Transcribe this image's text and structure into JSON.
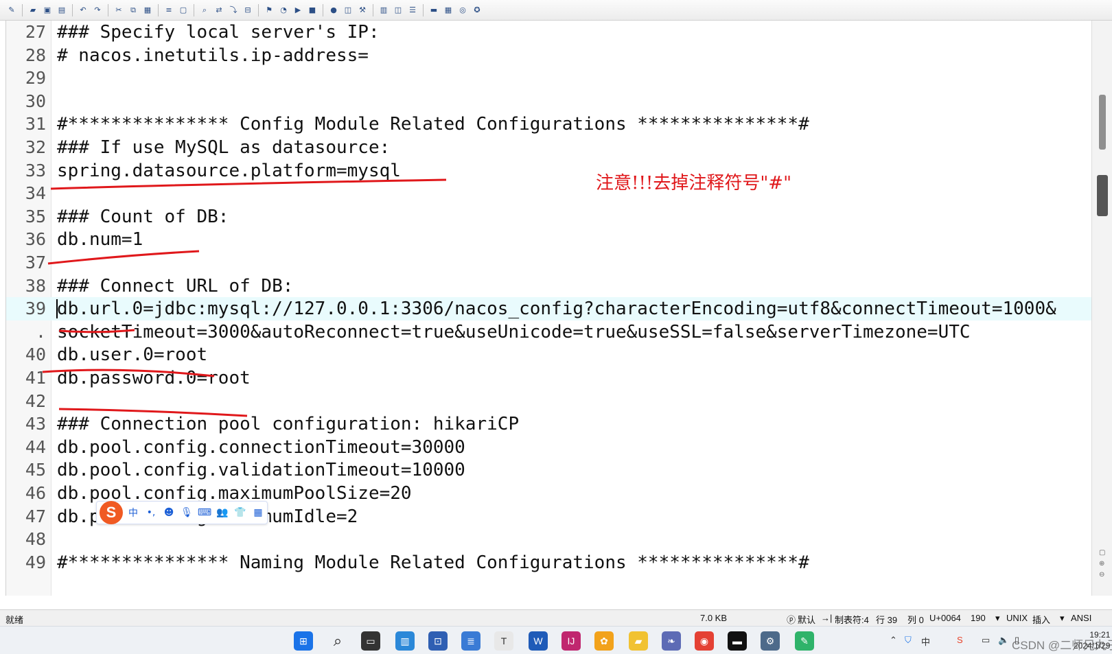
{
  "toolbar": {
    "buttons": [
      "new-icon",
      "open-icon",
      "save-icon",
      "save-all-icon",
      "undo-icon",
      "redo-icon",
      "cut-icon",
      "copy-icon",
      "paste-icon",
      "format-icon",
      "select-icon",
      "find-icon",
      "replace-icon",
      "goto-icon",
      "compare-icon",
      "bookmark-icon",
      "macro-icon",
      "macro-play-icon",
      "macro-stop-icon",
      "run-icon",
      "window-icon",
      "tools-icon",
      "view-icon",
      "split-icon",
      "list-icon",
      "console-icon",
      "column-icon",
      "browser-icon",
      "help-icon"
    ]
  },
  "editor": {
    "lines": [
      {
        "num": "27",
        "text": "### Specify local server's IP:"
      },
      {
        "num": "28",
        "text": "# nacos.inetutils.ip-address="
      },
      {
        "num": "29",
        "text": ""
      },
      {
        "num": "30",
        "text": ""
      },
      {
        "num": "31",
        "text": "#*************** Config Module Related Configurations ***************#"
      },
      {
        "num": "32",
        "text": "### If use MySQL as datasource:"
      },
      {
        "num": "33",
        "text": "spring.datasource.platform=mysql"
      },
      {
        "num": "34",
        "text": ""
      },
      {
        "num": "35",
        "text": "### Count of DB:"
      },
      {
        "num": "36",
        "text": "db.num=1"
      },
      {
        "num": "37",
        "text": ""
      },
      {
        "num": "38",
        "text": "### Connect URL of DB:"
      },
      {
        "num": "39",
        "text": "db.url.0=jdbc:mysql://127.0.0.1:3306/nacos_config?characterEncoding=utf8&connectTimeout=1000&"
      },
      {
        "num": ".",
        "text": "socketTimeout=3000&autoReconnect=true&useUnicode=true&useSSL=false&serverTimezone=UTC"
      },
      {
        "num": "40",
        "text": "db.user.0=root"
      },
      {
        "num": "41",
        "text": "db.password.0=root"
      },
      {
        "num": "42",
        "text": ""
      },
      {
        "num": "43",
        "text": "### Connection pool configuration: hikariCP"
      },
      {
        "num": "44",
        "text": "db.pool.config.connectionTimeout=30000"
      },
      {
        "num": "45",
        "text": "db.pool.config.validationTimeout=10000"
      },
      {
        "num": "46",
        "text": "db.pool.config.maximumPoolSize=20"
      },
      {
        "num": "47",
        "text": "db.pool.config.minimumIdle=2"
      },
      {
        "num": "48",
        "text": ""
      },
      {
        "num": "49",
        "text": "#*************** Naming Module Related Configurations ***************#"
      }
    ],
    "current_line": "39"
  },
  "annotation": {
    "note": "注意!!!去掉注释符号\"#\"",
    "color": "#e0181b"
  },
  "ime": {
    "logo": "S",
    "lang": "中",
    "icons": [
      "punctuation-icon",
      "emoji-icon",
      "microphone-icon",
      "keyboard-icon",
      "user-icon",
      "skin-icon",
      "grid-icon"
    ]
  },
  "statusbar": {
    "ready": "就绪",
    "size": "7.0 KB",
    "scheme": "默认",
    "tab": "制表符:4",
    "line": "行 39",
    "col": "列 0",
    "char": "U+0064",
    "count": "190",
    "eol": "UNIX",
    "mode": "插入",
    "encoding": "ANSI"
  },
  "taskbar": {
    "tray_lang": "中",
    "time": "19:21",
    "date": "2024/1/29",
    "watermark": "CSDN @二师兄丸子"
  }
}
